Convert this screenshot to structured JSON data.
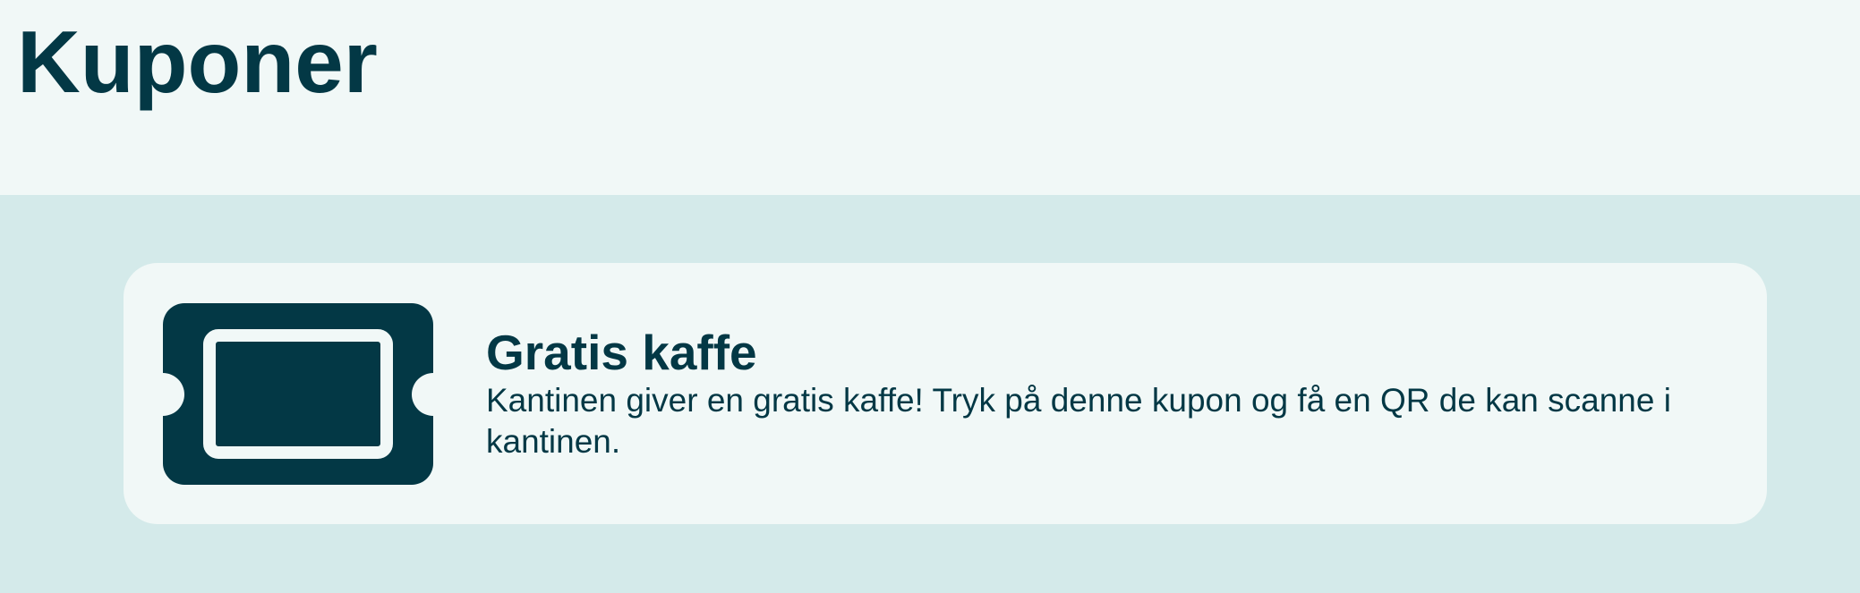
{
  "header": {
    "title": "Kuponer"
  },
  "coupons": [
    {
      "icon": "ticket-icon",
      "title": "Gratis kaffe",
      "description": "Kantinen giver en gratis kaffe! Tryk på denne kupon og få en QR de kan scanne i kantinen."
    }
  ],
  "colors": {
    "primary": "#033845",
    "header_bg": "#f1f8f7",
    "content_bg": "#d4eaea",
    "card_bg": "#f1f8f7"
  }
}
